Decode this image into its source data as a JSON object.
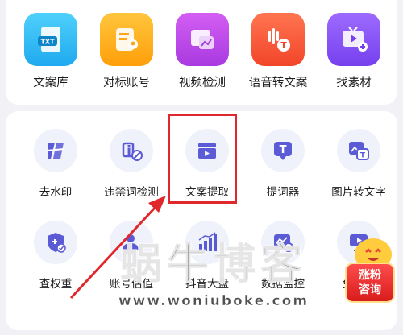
{
  "top_tools": [
    {
      "label": "文案库",
      "icon": "txt-file-icon",
      "tile_color": "#33c1f5",
      "badge": "TXT"
    },
    {
      "label": "对标账号",
      "icon": "account-card-icon",
      "tile_color": "#ffb31a"
    },
    {
      "label": "视频检测",
      "icon": "video-chart-icon",
      "tile_color": "#c04ae8"
    },
    {
      "label": "语音转文案",
      "icon": "voice-to-text-icon",
      "tile_color": "#ff5b3a"
    },
    {
      "label": "找素材",
      "icon": "tv-add-icon",
      "tile_color": "#8a53f5"
    }
  ],
  "features_row1": [
    {
      "label": "去水印",
      "icon": "remove-watermark-icon"
    },
    {
      "label": "违禁词检测",
      "icon": "banned-word-icon"
    },
    {
      "label": "文案提取",
      "icon": "clapperboard-icon"
    },
    {
      "label": "提词器",
      "icon": "teleprompter-icon"
    },
    {
      "label": "图片转文字",
      "icon": "image-to-text-icon"
    }
  ],
  "features_row2": [
    {
      "label": "查权重",
      "icon": "shield-check-icon"
    },
    {
      "label": "账号估值",
      "icon": "account-value-icon"
    },
    {
      "label": "抖音大盘",
      "icon": "bar-chart-icon"
    },
    {
      "label": "数据监控",
      "icon": "data-monitor-icon"
    },
    {
      "label": "免费咨",
      "icon": "consult-monitor-icon"
    }
  ],
  "accent_color": "#5b5bd6",
  "highlight_color": "#e0282c",
  "watermark": {
    "title": "蜗牛博客",
    "url": "www.woniuboke.com"
  },
  "consult_badge": {
    "line1": "涨粉",
    "line2": "咨询"
  }
}
